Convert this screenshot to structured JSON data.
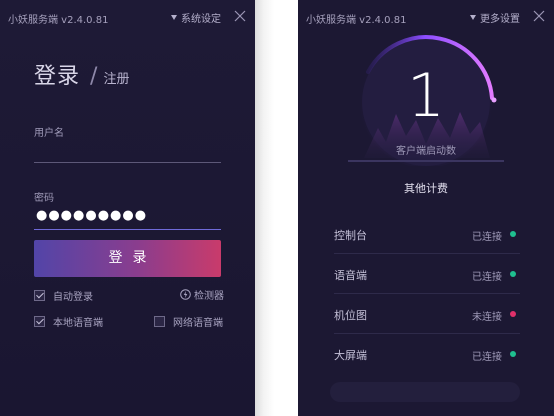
{
  "left_window": {
    "app_title": "小妖服务端 v2.4.0.81",
    "settings_menu_label": "系统设定",
    "heading": {
      "login": "登录",
      "separator": "/",
      "register": "注册"
    },
    "username": {
      "label": "用户名",
      "value": ""
    },
    "password": {
      "label": "密码",
      "masked_value": "●●●●●●●●●"
    },
    "login_button_label": "登录",
    "options": {
      "auto_login": {
        "label": "自动登录",
        "checked": true
      },
      "detector": {
        "label": "检测器"
      },
      "local_voice": {
        "label": "本地语音端",
        "checked": true
      },
      "network_voice": {
        "label": "网络语音端",
        "checked": false
      }
    }
  },
  "right_window": {
    "app_title": "小妖服务端 v2.4.0.81",
    "settings_menu_label": "更多设置",
    "client_count": "1",
    "client_count_label": "客户端启动数",
    "other_label": "其他计费",
    "connections": [
      {
        "name": "控制台",
        "status": "已连接",
        "dot_color": "#1fbf8f"
      },
      {
        "name": "语音端",
        "status": "已连接",
        "dot_color": "#1fbf8f"
      },
      {
        "name": "机位图",
        "status": "未连接",
        "dot_color": "#e0306a"
      },
      {
        "name": "大屏端",
        "status": "已连接",
        "dot_color": "#1fbf8f"
      }
    ]
  },
  "colors": {
    "window_bg": "#1c1833",
    "accent_purple": "#7a3fe0",
    "button_start": "#5245a8",
    "button_end": "#c93b6b",
    "connected": "#1fbf8f",
    "disconnected": "#e0306a"
  },
  "icons": {
    "menu_arrow": "triangle-down-icon",
    "close": "close-icon",
    "detector": "lightning-circle-icon",
    "checkbox": "checkbox-icon",
    "status_dot": "status-dot-icon"
  }
}
